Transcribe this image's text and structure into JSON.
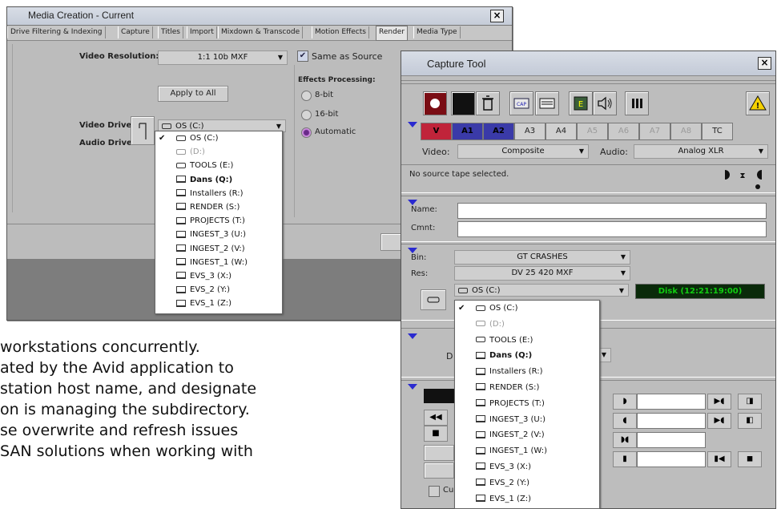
{
  "background_text": [
    "workstations concurrently.",
    "ated by the Avid application to",
    "station host name, and designate",
    "on is managing the subdirectory.",
    "se overwrite and refresh issues",
    " SAN solutions when working with"
  ],
  "media_creation": {
    "title": "Media Creation - Current",
    "close": "×",
    "tabs": [
      "Drive Filtering & Indexing",
      "Capture",
      "Titles",
      "Import",
      "Mixdown & Transcode",
      "Motion Effects",
      "Render",
      "Media Type"
    ],
    "active_tab": "Render",
    "video_resolution_label": "Video Resolution:",
    "video_resolution_value": "1:1 10b  MXF",
    "same_as_source_label": "Same as Source",
    "same_as_source_checked": true,
    "apply_to_all": "Apply to All",
    "effects_processing_label": "Effects Processing:",
    "effects_options": [
      "8-bit",
      "16-bit",
      "Automatic"
    ],
    "effects_selected": "Automatic",
    "video_drive_label": "Video Drive:",
    "audio_drive_label": "Audio Drive:",
    "drive_value": "OS (C:)"
  },
  "drive_menu": {
    "items": [
      {
        "label": "OS (C:)",
        "checked": true,
        "type": "disk",
        "bold": false,
        "disabled": false
      },
      {
        "label": "(D:)",
        "checked": false,
        "type": "disk",
        "bold": false,
        "disabled": true
      },
      {
        "label": "TOOLS (E:)",
        "checked": false,
        "type": "disk",
        "bold": false,
        "disabled": false
      },
      {
        "label": "Dans (Q:)",
        "checked": false,
        "type": "network",
        "bold": true,
        "disabled": false
      },
      {
        "label": "Installers (R:)",
        "checked": false,
        "type": "network",
        "bold": false,
        "disabled": false
      },
      {
        "label": "RENDER (S:)",
        "checked": false,
        "type": "network",
        "bold": false,
        "disabled": false
      },
      {
        "label": "PROJECTS (T:)",
        "checked": false,
        "type": "network",
        "bold": false,
        "disabled": false
      },
      {
        "label": "INGEST_3 (U:)",
        "checked": false,
        "type": "network",
        "bold": false,
        "disabled": false
      },
      {
        "label": "INGEST_2 (V:)",
        "checked": false,
        "type": "network",
        "bold": false,
        "disabled": false
      },
      {
        "label": "INGEST_1 (W:)",
        "checked": false,
        "type": "network",
        "bold": false,
        "disabled": false
      },
      {
        "label": "EVS_3 (X:)",
        "checked": false,
        "type": "network",
        "bold": false,
        "disabled": false
      },
      {
        "label": "EVS_2 (Y:)",
        "checked": false,
        "type": "network",
        "bold": false,
        "disabled": false
      },
      {
        "label": "EVS_1 (Z:)",
        "checked": false,
        "type": "network",
        "bold": false,
        "disabled": false
      }
    ]
  },
  "capture_tool": {
    "title": "Capture Tool",
    "close": "×",
    "tracks": [
      "V",
      "A1",
      "A2",
      "A3",
      "A4",
      "A5",
      "A6",
      "A7",
      "A8",
      "TC"
    ],
    "video_label": "Video:",
    "video_value": "Composite",
    "audio_label": "Audio:",
    "audio_value": "Analog XLR",
    "source_status": "No source tape selected.",
    "name_label": "Name:",
    "cmnt_label": "Cmnt:",
    "bin_label": "Bin:",
    "bin_value": "GT CRASHES",
    "res_label": "Res:",
    "res_value": "DV 25 420  MXF",
    "drive_value": "OS (C:)",
    "disk_time": "Disk (12:21:19:00)",
    "partial_d": "D",
    "partial_cu": "Cu",
    "colors": {
      "disk_time_text": "#11cc11",
      "disk_time_bg": "#0a2a0a"
    }
  }
}
